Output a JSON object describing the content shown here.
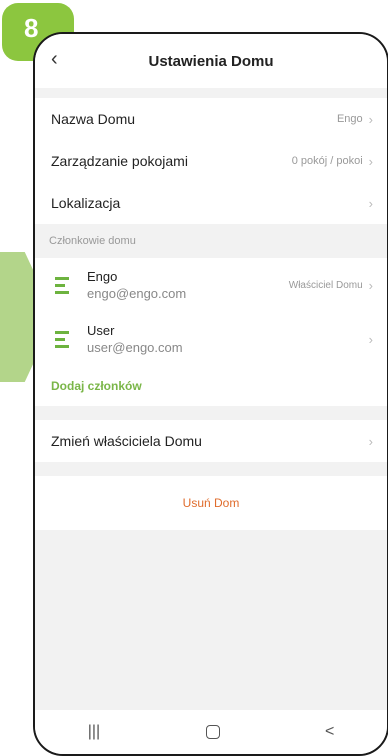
{
  "step": {
    "number": "8"
  },
  "header": {
    "title": "Ustawienia Domu",
    "back_icon": "chevron-left-icon"
  },
  "settings": [
    {
      "label": "Nazwa Domu",
      "value": "Engo"
    },
    {
      "label": "Zarządzanie pokojami",
      "value": "0 pokój / pokoi"
    },
    {
      "label": "Lokalizacja",
      "value": ""
    }
  ],
  "members_section": {
    "title": "Członkowie domu",
    "members": [
      {
        "name": "Engo",
        "email": "engo@engo.com",
        "role": "Właściciel Domu"
      },
      {
        "name": "User",
        "email": "user@engo.com",
        "role": ""
      }
    ],
    "add_label": "Dodaj członków"
  },
  "transfer": {
    "label": "Zmień właściciela Domu"
  },
  "delete": {
    "label": "Usuń Dom"
  },
  "nav": {
    "recent": "|||",
    "home": "home-icon",
    "back": "<"
  },
  "colors": {
    "accent": "#8cc63f",
    "arrow": "#b3d58a",
    "danger": "#e06c2c"
  }
}
